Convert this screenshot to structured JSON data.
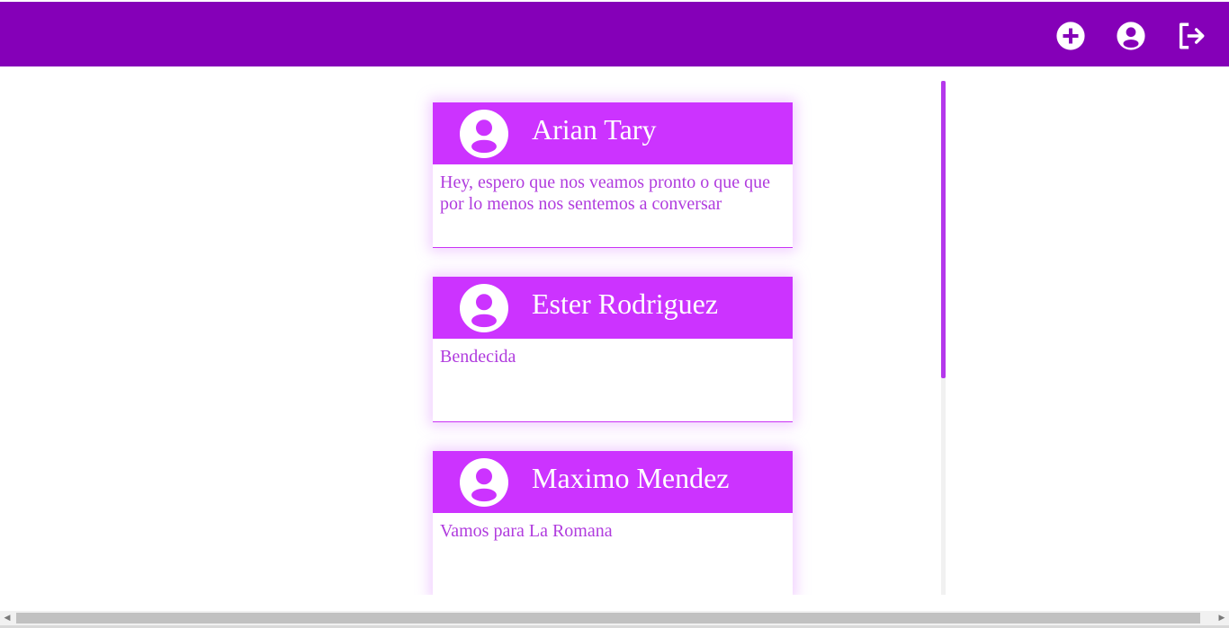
{
  "header": {
    "color": "#8500b8",
    "icons": [
      "add-circle-icon",
      "account-circle-icon",
      "logout-icon"
    ]
  },
  "posts": [
    {
      "author": "Arian Tary",
      "message": "Hey, espero que nos veamos pronto o que que por lo menos nos sentemos a conversar"
    },
    {
      "author": "Ester Rodriguez",
      "message": "Bendecida"
    },
    {
      "author": "Maximo Mendez",
      "message": "Vamos para La Romana"
    }
  ],
  "colors": {
    "card_header": "#cc33ff",
    "message_text": "#b03cde",
    "scroll_thumb": "#b538ec"
  }
}
